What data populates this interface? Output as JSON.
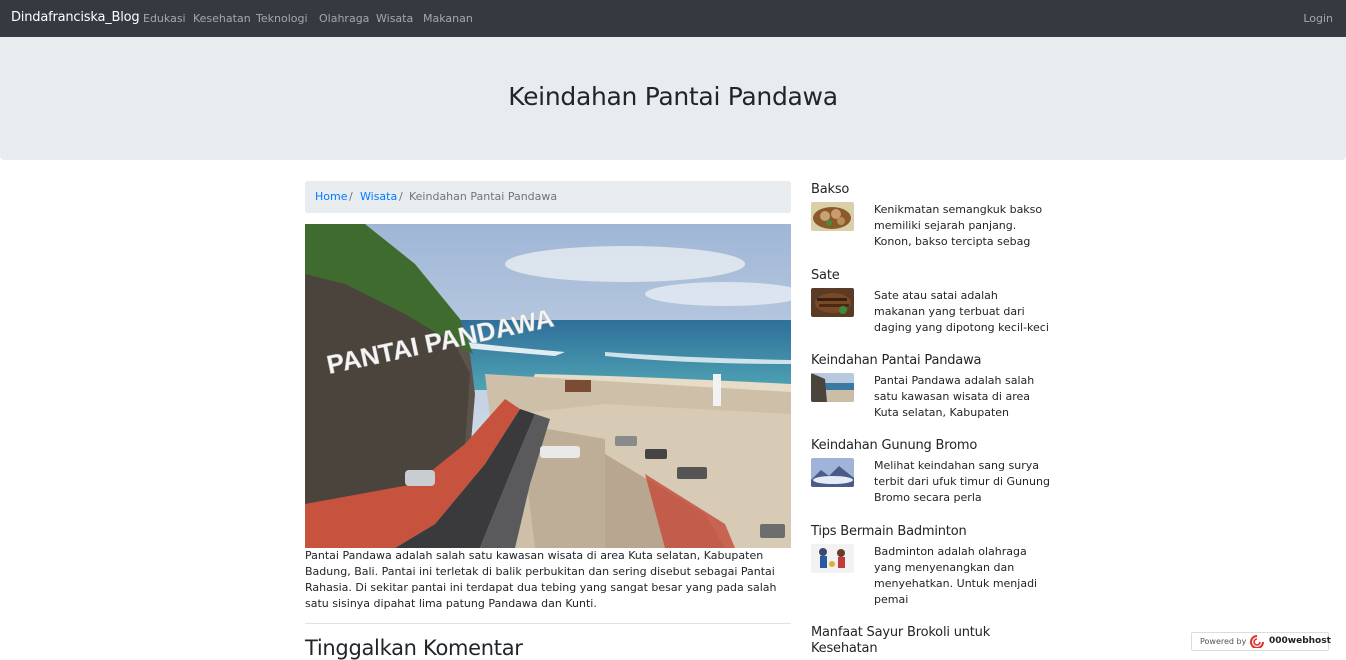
{
  "navbar": {
    "brand": "Dindafranciska_Blog",
    "items": [
      "Edukasi",
      "Kesehatan",
      "Teknologi",
      "Olahraga",
      "Wisata",
      "Makanan"
    ],
    "login": "Login"
  },
  "header": {
    "title": "Keindahan Pantai Pandawa"
  },
  "breadcrumb": {
    "home": "Home",
    "category": "Wisata",
    "current": "Keindahan Pantai Pandawa",
    "separator": "/"
  },
  "article": {
    "image_icon": "beach-photo",
    "sign_text": "PANTAI PANDAWA",
    "text": "Pantai Pandawa adalah salah satu kawasan wisata di area Kuta selatan, Kabupaten Badung, Bali. Pantai ini terletak di balik perbukitan dan sering disebut sebagai Pantai Rahasia. Di sekitar pantai ini terdapat dua tebing yang sangat besar yang pada salah satu sisinya dipahat lima patung Pandawa dan Kunti."
  },
  "comments": {
    "title": "Tinggalkan Komentar"
  },
  "sidebar": {
    "items": [
      {
        "title": "Bakso",
        "excerpt": "Kenikmatan semangkuk bakso memiliki sejarah panjang. Konon, bakso tercipta sebag"
      },
      {
        "title": "Sate",
        "excerpt": "Sate atau satai adalah makanan yang terbuat dari daging yang dipotong kecil-keci"
      },
      {
        "title": "Keindahan Pantai Pandawa",
        "excerpt": "Pantai Pandawa adalah salah satu kawasan wisata di area Kuta selatan, Kabupaten"
      },
      {
        "title": "Keindahan Gunung Bromo",
        "excerpt": "Melihat keindahan sang surya terbit dari ufuk timur di Gunung Bromo secara perla"
      },
      {
        "title": "Tips Bermain Badminton",
        "excerpt": "Badminton adalah olahraga yang menyenangkan dan menyehatkan. Untuk menjadi pemai"
      },
      {
        "title": "Manfaat Sayur Brokoli untuk Kesehatan",
        "excerpt": ""
      }
    ]
  },
  "footer_badge": {
    "label": "Powered by",
    "name": "000webhost"
  }
}
